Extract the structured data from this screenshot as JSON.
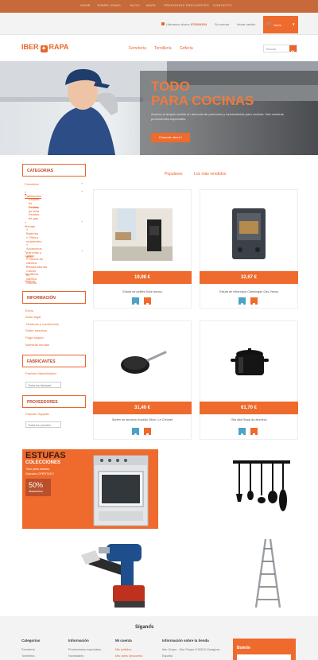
{
  "topnav": {
    "items": [
      "HOME",
      "SOBRE IGBAG",
      "BLOG",
      "MAPA",
      "PREGUNTAS FRECUENTES",
      "CONTACTO"
    ]
  },
  "header": {
    "phone_label": "Llámanos ahora:",
    "phone_number": "976543454",
    "contact_link": "Su cuenta",
    "login_link": "Iniciar sesión",
    "cart_label": "Vacío",
    "logo_left": "IBER",
    "logo_right": "RAPA",
    "nav": [
      "Ferretería",
      "Tornillería",
      "Grifería"
    ],
    "search_placeholder": "Buscar"
  },
  "hero": {
    "title_line1": "TODO",
    "title_line2": "PARA COCINAS",
    "description": "Somos un amplio surtido en artículos de productos y herramientas para cocinas. Vea nuestras promociones especiales.",
    "cta": "Comprar ahora !"
  },
  "sidebar": {
    "categories_title": "CATEGORIAS",
    "categories": [
      {
        "label": "Ferretería",
        "toggle": "+"
      },
      {
        "label": "» Calefacción",
        "toggle": "+"
      },
      {
        "label": "Estufas de Pellets",
        "toggle": ""
      },
      {
        "label": "Estufas de leña",
        "toggle": ""
      },
      {
        "label": "Estufas de gas",
        "toggle": ""
      },
      {
        "label": "» Menaje",
        "toggle": "+"
      },
      {
        "label": "» Baterías",
        "toggle": ""
      },
      {
        "label": "» Ollas y recipientes",
        "toggle": ""
      },
      {
        "label": "» Accesorios planchas y grills",
        "toggle": ""
      },
      {
        "label": "» Clavos",
        "toggle": "+"
      },
      {
        "label": "» Clavos de cabeza Plana/redonda",
        "toggle": ""
      },
      {
        "label": "» Clavos de cabeza Rabeta",
        "toggle": ""
      },
      {
        "label": "Tornillería",
        "toggle": ""
      },
      {
        "label": "Grifería",
        "toggle": ""
      }
    ],
    "info_title": "INFORMACIÓN",
    "info_links": [
      "Envío",
      "Aviso legal",
      "Términos y condiciones",
      "Sobre nosotros",
      "Pago seguro",
      "Nuestras tiendas"
    ],
    "brands_title": "FABRICANTES",
    "brands_item": "Fashion Manufacturer",
    "brands_select": "Todos los fabricant...",
    "suppliers_title": "PROVEEDORES",
    "suppliers_item": "Fashion Supplier",
    "suppliers_select": "Todos los proveed..."
  },
  "tabs": [
    "Populares",
    "Los más vendidos"
  ],
  "products": [
    {
      "price": "19,98 €",
      "name": "Estufa de pellets Dola blanca"
    },
    {
      "price": "32,67 €",
      "name": "Estufa de infrarrojos Campingaz Gas Venus"
    },
    {
      "price": "31,46 €",
      "name": "Sartén de aluminio fundido 28cm. Le Creuset"
    },
    {
      "price": "61,70 €",
      "name": "Olla alta Royal de aluminio"
    }
  ],
  "promo": {
    "title": "ESTUFAS",
    "subtitle": "COLECCIONES",
    "line1": "Todo para estufas",
    "line2": "Grandes OFERTAS !!",
    "discount": "50%",
    "discount_sub": "descuentos"
  },
  "footer": {
    "follow": "Síganos",
    "col1_title": "Categorías",
    "col1_links": [
      "Ferretería",
      "Tornillería"
    ],
    "col2_title": "Información",
    "col2_links": [
      "Promociones especiales",
      "Novedades"
    ],
    "col3_title": "Mi cuenta",
    "col3_links": [
      "Mis pedidos",
      "Mis vales descuento"
    ],
    "col4_title": "Información sobre la tienda",
    "col4_lines": [
      "Iber Grupo - San Roque 8 50010 Zaragoza",
      "España"
    ],
    "newsletter_title": "Boletín"
  },
  "colors": {
    "accent": "#ee6a2d",
    "topbar": "#c8693a",
    "dark_accent": "#c0482a"
  }
}
